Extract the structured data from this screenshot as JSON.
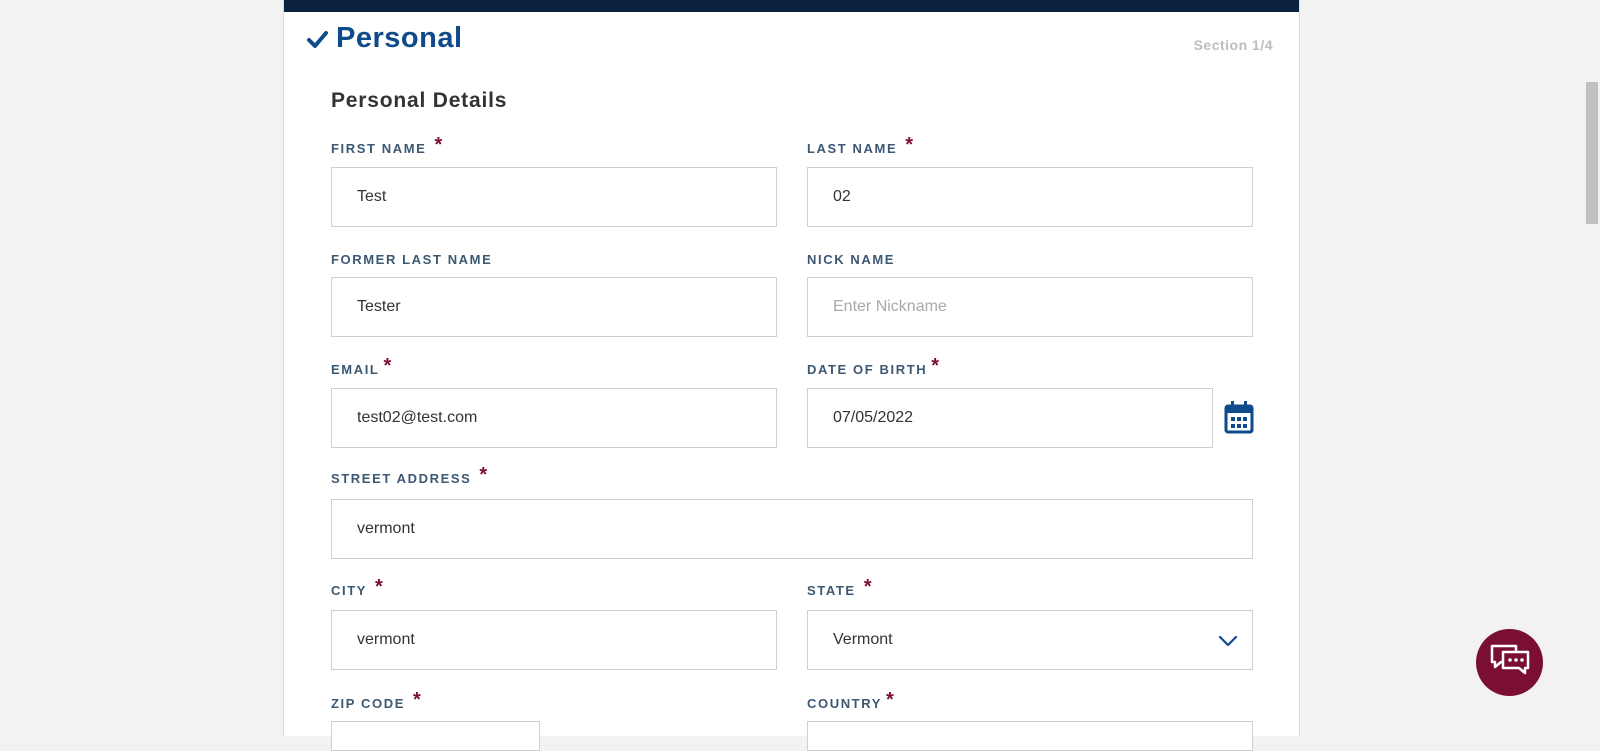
{
  "section": {
    "title": "Personal",
    "counter": "Section 1/4"
  },
  "subtitle": "Personal Details",
  "required_mark": "*",
  "fields": {
    "first_name": {
      "label": "FIRST NAME",
      "value": "Test"
    },
    "last_name": {
      "label": "LAST NAME",
      "value": "02"
    },
    "former_last_name": {
      "label": "FORMER LAST NAME",
      "value": "Tester"
    },
    "nick_name": {
      "label": "NICK NAME",
      "value": "",
      "placeholder": "Enter Nickname"
    },
    "email": {
      "label": "EMAIL",
      "value": "test02@test.com"
    },
    "dob": {
      "label": "DATE OF BIRTH",
      "value": "07/05/2022"
    },
    "street": {
      "label": "STREET ADDRESS",
      "value": "vermont"
    },
    "city": {
      "label": "CITY",
      "value": "vermont"
    },
    "state": {
      "label": "STATE",
      "value": "Vermont"
    },
    "zip": {
      "label": "ZIP CODE",
      "value": ""
    },
    "country": {
      "label": "COUNTRY",
      "value": ""
    }
  },
  "colors": {
    "header_bar": "#0a2240",
    "accent_blue": "#0f4a8a",
    "required": "#7a0f33",
    "chat_button": "#7a0f33"
  },
  "icons": {
    "section_status": "check-icon",
    "date_picker": "calendar-icon",
    "state_select": "chevron-down-icon",
    "chat": "chat-icon"
  }
}
